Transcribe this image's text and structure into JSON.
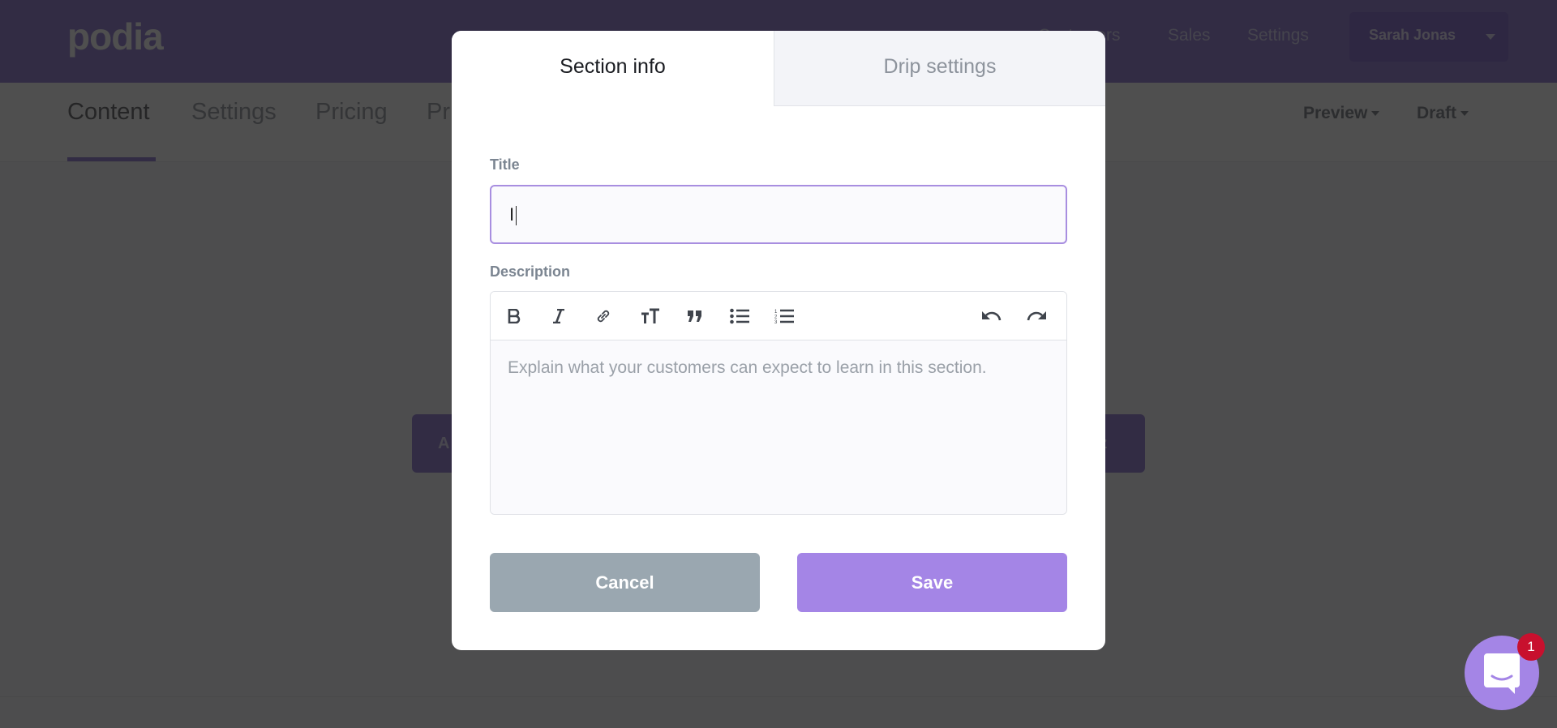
{
  "app": {
    "logo": "podia",
    "top_nav": {
      "visible_items": [
        "Customers",
        "Sales",
        "Settings"
      ],
      "user": "Sarah Jonas"
    },
    "sub_nav": {
      "tabs": [
        {
          "label": "Content",
          "active": true
        },
        {
          "label": "Settings",
          "active": false
        },
        {
          "label": "Pricing",
          "active": false
        },
        {
          "label": "Pr",
          "active": false
        }
      ],
      "right": [
        {
          "label": "Preview"
        },
        {
          "label": "Draft"
        }
      ]
    },
    "background_buttons": [
      {
        "label": "A"
      },
      {
        "label": "iz"
      }
    ]
  },
  "modal": {
    "tabs": [
      {
        "label": "Section info",
        "active": true
      },
      {
        "label": "Drip settings",
        "active": false
      }
    ],
    "title_label": "Title",
    "title_value": "I",
    "description_label": "Description",
    "description_placeholder": "Explain what your customers can expect to learn in this section.",
    "toolbar": [
      "bold",
      "italic",
      "link",
      "heading",
      "quote",
      "bullet-list",
      "numbered-list",
      "undo",
      "redo"
    ],
    "cancel_label": "Cancel",
    "save_label": "Save"
  },
  "chat": {
    "badge_count": "1"
  },
  "colors": {
    "brand": "#5d3fbf",
    "save": "#a485e6",
    "cancel": "#9aa7b0",
    "badge": "#c8102e"
  }
}
